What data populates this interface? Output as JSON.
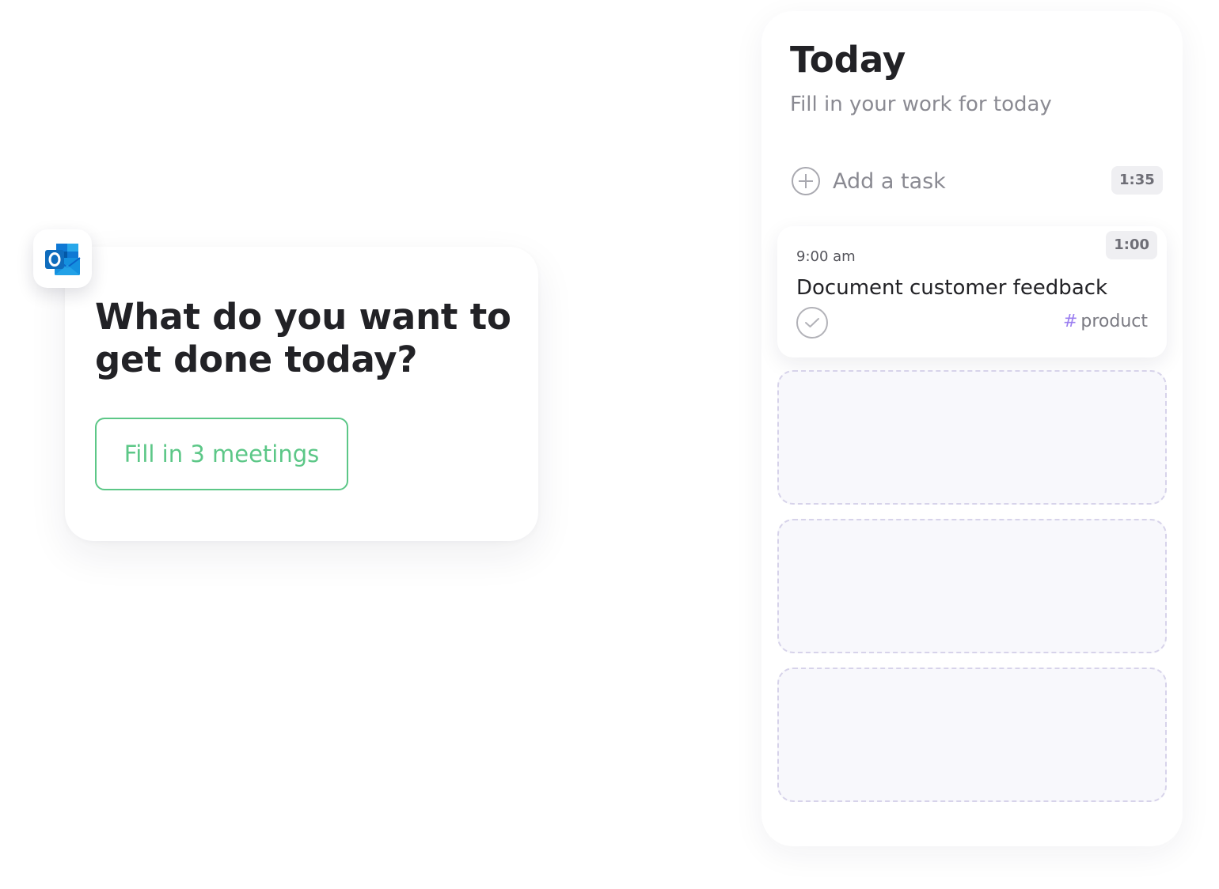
{
  "prompt_card": {
    "app_icon": "outlook-icon",
    "title": "What do you want to get done today?",
    "button_label": "Fill in 3 meetings",
    "accent_color": "#5cc787"
  },
  "today_panel": {
    "title": "Today",
    "subtitle": "Fill in your work for today",
    "add_task": {
      "icon": "plus-circle-icon",
      "label": "Add a task",
      "duration": "1:35"
    },
    "tasks": [
      {
        "time": "9:00 am",
        "duration": "1:00",
        "title": "Document customer feedback",
        "check_icon": "checkmark-circle-icon",
        "tag_hash": "#",
        "tag": "product",
        "tag_color": "#9b7ff0"
      }
    ],
    "empty_slots": 3
  }
}
